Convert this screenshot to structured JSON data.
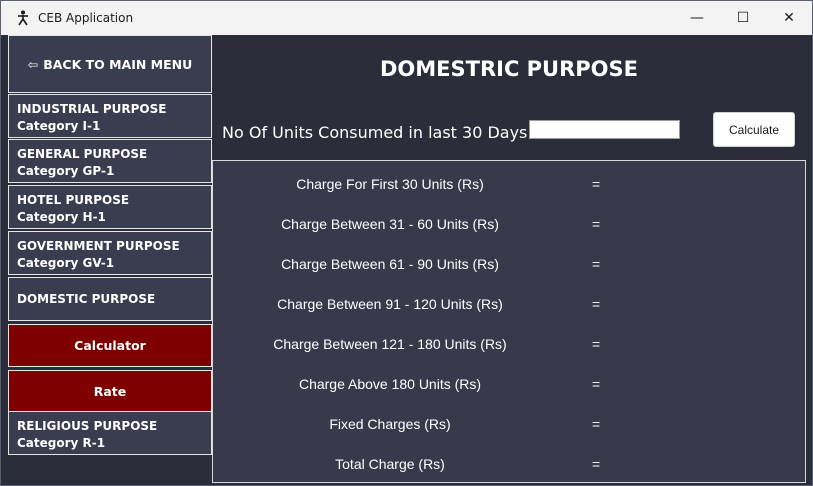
{
  "window": {
    "title": "CEB Application",
    "minimize": "—",
    "maximize": "☐",
    "close": "✕"
  },
  "sidebar": {
    "back_arrow": "⇦",
    "back_label": "BACK TO MAIN MENU",
    "items": [
      {
        "title": "INDUSTRIAL PURPOSE",
        "category": "Category I-1"
      },
      {
        "title": "GENERAL PURPOSE",
        "category": "Category GP-1"
      },
      {
        "title": "HOTEL PURPOSE",
        "category": "Category H-1"
      },
      {
        "title": "GOVERNMENT PURPOSE",
        "category": "Category GV-1"
      },
      {
        "title": "DOMESTIC PURPOSE",
        "category": ""
      },
      {
        "title": "RELIGIOUS PURPOSE",
        "category": "Category R-1"
      }
    ],
    "sub_buttons": [
      "Calculator",
      "Rate"
    ]
  },
  "main": {
    "title": "DOMESTRIC PURPOSE",
    "units_label": "No Of Units Consumed in last 30 Days :",
    "units_value": "",
    "calculate_label": "Calculate",
    "results": [
      {
        "label": "Charge For First 30 Units (Rs)",
        "eq": "="
      },
      {
        "label": "Charge Between 31 - 60 Units (Rs)",
        "eq": "="
      },
      {
        "label": "Charge Between 61 - 90 Units (Rs)",
        "eq": "="
      },
      {
        "label": "Charge Between 91 - 120 Units (Rs)",
        "eq": "="
      },
      {
        "label": "Charge Between 121 - 180 Units (Rs)",
        "eq": "="
      },
      {
        "label": "Charge Above 180 Units (Rs)",
        "eq": "="
      },
      {
        "label": "Fixed Charges (Rs)",
        "eq": "="
      },
      {
        "label": "Total Charge (Rs)",
        "eq": "="
      }
    ]
  },
  "colors": {
    "accent_red": "#7f0000",
    "panel": "#3a3c4f",
    "background": "#2b2d3a"
  }
}
